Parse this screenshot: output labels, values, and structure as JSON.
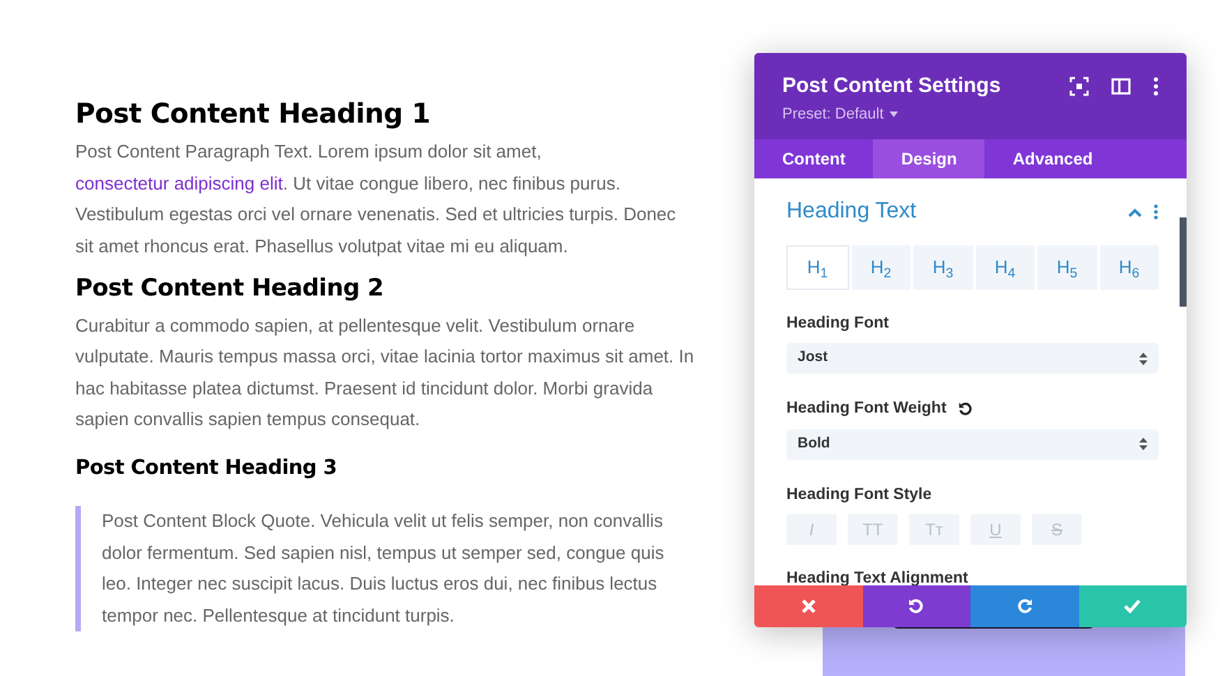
{
  "article": [
    {
      "kind": "h1",
      "text": "Post Content Heading 1"
    },
    {
      "kind": "paragraph",
      "parts": [
        {
          "kind": "text",
          "text": "Post Content Paragraph Text. Lorem ipsum dolor sit amet, "
        },
        {
          "kind": "link",
          "text": "consectetur adipiscing elit"
        },
        {
          "kind": "text",
          "text": ". Ut vitae congue libero, nec finibus purus. Vestibulum egestas orci vel ornare venenatis. Sed et ultricies turpis. Donec sit amet rhoncus erat. Phasellus volutpat vitae mi eu aliquam."
        }
      ]
    },
    {
      "kind": "h2",
      "text": "Post Content Heading 2"
    },
    {
      "kind": "paragraph",
      "parts": [
        {
          "kind": "text",
          "text": "Curabitur a commodo sapien, at pellentesque velit. Vestibulum ornare vulputate. Mauris tempus massa orci, vitae lacinia tortor maximus sit amet. In hac habitasse platea dictumst. Praesent id tincidunt dolor. Morbi gravida sapien convallis sapien tempus consequat."
        }
      ]
    },
    {
      "kind": "h3",
      "text": "Post Content Heading 3"
    },
    {
      "kind": "blockquote",
      "parts": [
        {
          "kind": "text",
          "text": "Post Content Block Quote. Vehicula velit ut felis semper, non convallis dolor fermentum. Sed sapien nisl, tempus ut semper sed, congue quis leo. Integer nec suscipit lacus. Duis luctus eros dui, nec finibus lectus tempor nec. Pellentesque at tincidunt turpis."
        }
      ]
    }
  ],
  "panel": {
    "title": "Post Content Settings",
    "preset": "Preset: Default",
    "tabs": [
      {
        "label": "Content",
        "selected": false
      },
      {
        "label": "Design",
        "selected": true
      },
      {
        "label": "Advanced",
        "selected": false
      }
    ],
    "section": {
      "title": "Heading Text",
      "expanded": true
    },
    "heading_levels": [
      {
        "label": "H$_{1}$",
        "selected": true
      },
      {
        "label": "H$_{2}$",
        "selected": false
      },
      {
        "label": "H$_{3}$",
        "selected": false
      },
      {
        "label": "H$_{4}$",
        "selected": false
      },
      {
        "label": "H$_{5}$",
        "selected": false
      },
      {
        "label": "H$_{6}$",
        "selected": false
      }
    ],
    "fields": [
      {
        "kind": "select",
        "label": "Heading Font",
        "value": "Jost"
      },
      {
        "kind": "select",
        "label": "Heading Font Weight",
        "value": "Bold",
        "reset": true
      },
      {
        "kind": "styles",
        "label": "Heading Font Style",
        "options": [
          {
            "label": "I",
            "selected": false
          },
          {
            "label": "TT",
            "selected": false
          },
          {
            "label": "Tᴛ",
            "selected": false
          },
          {
            "label": "U",
            "selected": false
          },
          {
            "label": "S",
            "selected": false
          }
        ]
      },
      {
        "kind": "heading",
        "label": "Heading Text Alignment"
      }
    ],
    "footer_buttons": [
      {
        "kind": "cancel"
      },
      {
        "kind": "undo"
      },
      {
        "kind": "redo"
      },
      {
        "kind": "save"
      }
    ]
  }
}
